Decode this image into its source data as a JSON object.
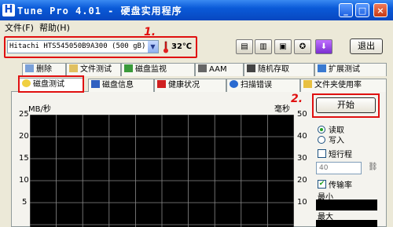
{
  "window": {
    "title": "Tune Pro 4.01 - 硬盘实用程序",
    "icon_letter": "H"
  },
  "titlebar_buttons": {
    "minimize": "_",
    "maximize": "□",
    "close": "×"
  },
  "menu": [
    {
      "label": "文件(F)"
    },
    {
      "label": "帮助(H)"
    }
  ],
  "toolbar": {
    "drive": "Hitachi HTS545050B9A300 (500 gB)",
    "temperature": "32℃",
    "exit_label": "退出",
    "icons": [
      "copy-icon",
      "copy-text-icon",
      "save-icon",
      "options-icon",
      "download-icon"
    ]
  },
  "annotations": {
    "marker1": "1.",
    "marker2": "2."
  },
  "tabs_row1": [
    {
      "label": "删除",
      "icon": "trash-icon"
    },
    {
      "label": "文件测试",
      "icon": "file-test-icon"
    },
    {
      "label": "磁盘监视",
      "icon": "monitor-icon"
    },
    {
      "label": "AAM",
      "icon": "speaker-icon"
    },
    {
      "label": "随机存取",
      "icon": "random-access-icon"
    },
    {
      "label": "扩展测试",
      "icon": "extended-test-icon"
    }
  ],
  "tabs_row2": [
    {
      "label": "磁盘测试",
      "icon": "lightbulb-icon"
    },
    {
      "label": "磁盘信息",
      "icon": "info-icon"
    },
    {
      "label": "健康状况",
      "icon": "health-icon"
    },
    {
      "label": "扫描错误",
      "icon": "magnifier-icon"
    },
    {
      "label": "文件夹使用率",
      "icon": "folder-icon"
    }
  ],
  "chart": {
    "left_unit": "MB/秒",
    "right_unit": "毫秒",
    "left_ticks": [
      "25",
      "20",
      "15",
      "10",
      "5"
    ],
    "right_ticks": [
      "50",
      "40",
      "30",
      "20",
      "10"
    ]
  },
  "controls": {
    "start_label": "开始",
    "read_label": "读取",
    "write_label": "写入",
    "short_stroke_label": "短行程",
    "short_stroke_value": "40",
    "transfer_rate_label": "传输率",
    "min_label": "最小",
    "max_label": "最大"
  }
}
